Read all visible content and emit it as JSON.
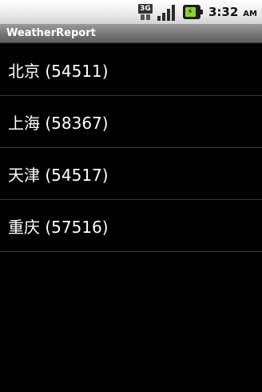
{
  "status_bar": {
    "network_label": "3G",
    "time": "3:32",
    "ampm": "AM",
    "icons": [
      "3g-icon",
      "signal-icon",
      "battery-icon"
    ]
  },
  "app": {
    "title": "WeatherReport"
  },
  "cities": [
    {
      "label": "北京 (54511)"
    },
    {
      "label": "上海 (58367)"
    },
    {
      "label": "天津 (54517)"
    },
    {
      "label": "重庆 (57516)"
    }
  ],
  "colors": {
    "background": "#000000",
    "text": "#ffffff",
    "divider": "#3a3a3a",
    "battery": "#8bd62a"
  }
}
